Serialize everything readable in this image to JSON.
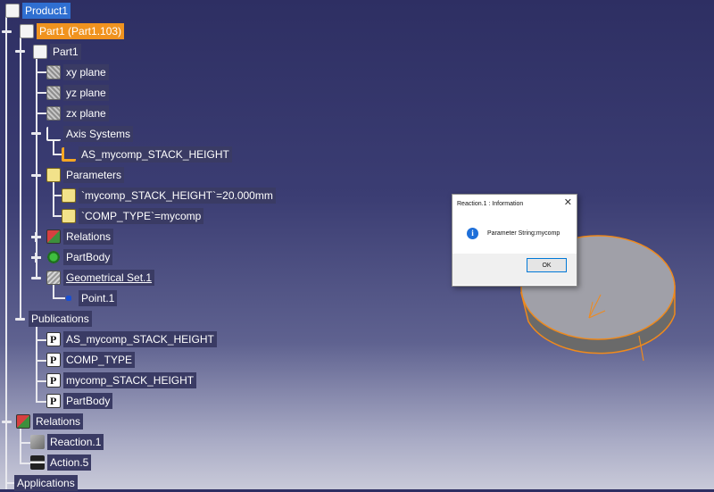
{
  "tree": {
    "product": "Product1",
    "part_instance": "Part1 (Part1.103)",
    "part": "Part1",
    "xy_plane": "xy plane",
    "yz_plane": "yz plane",
    "zx_plane": "zx plane",
    "axis_systems": "Axis Systems",
    "axis_item": "AS_mycomp_STACK_HEIGHT",
    "parameters": "Parameters",
    "param1": "`mycomp_STACK_HEIGHT`=20.000mm",
    "param2": "`COMP_TYPE`=mycomp",
    "relations": "Relations",
    "partbody": "PartBody",
    "geo_set": "Geometrical Set.1",
    "point": "Point.1",
    "publications": "Publications",
    "pub1": "AS_mycomp_STACK_HEIGHT",
    "pub2": "COMP_TYPE",
    "pub3": "mycomp_STACK_HEIGHT",
    "pub4": "PartBody",
    "root_relations": "Relations",
    "reaction": "Reaction.1",
    "action": "Action.5",
    "applications": "Applications"
  },
  "dialog": {
    "title": "Reaction.1 : Information",
    "close": "✕",
    "icon": "i",
    "message": "Parameter String:mycomp",
    "ok": "OK"
  },
  "colors": {
    "selection_blue": "#2f6fd1",
    "selection_orange": "#f0931f",
    "cylinder_edge": "#f08a1c"
  }
}
